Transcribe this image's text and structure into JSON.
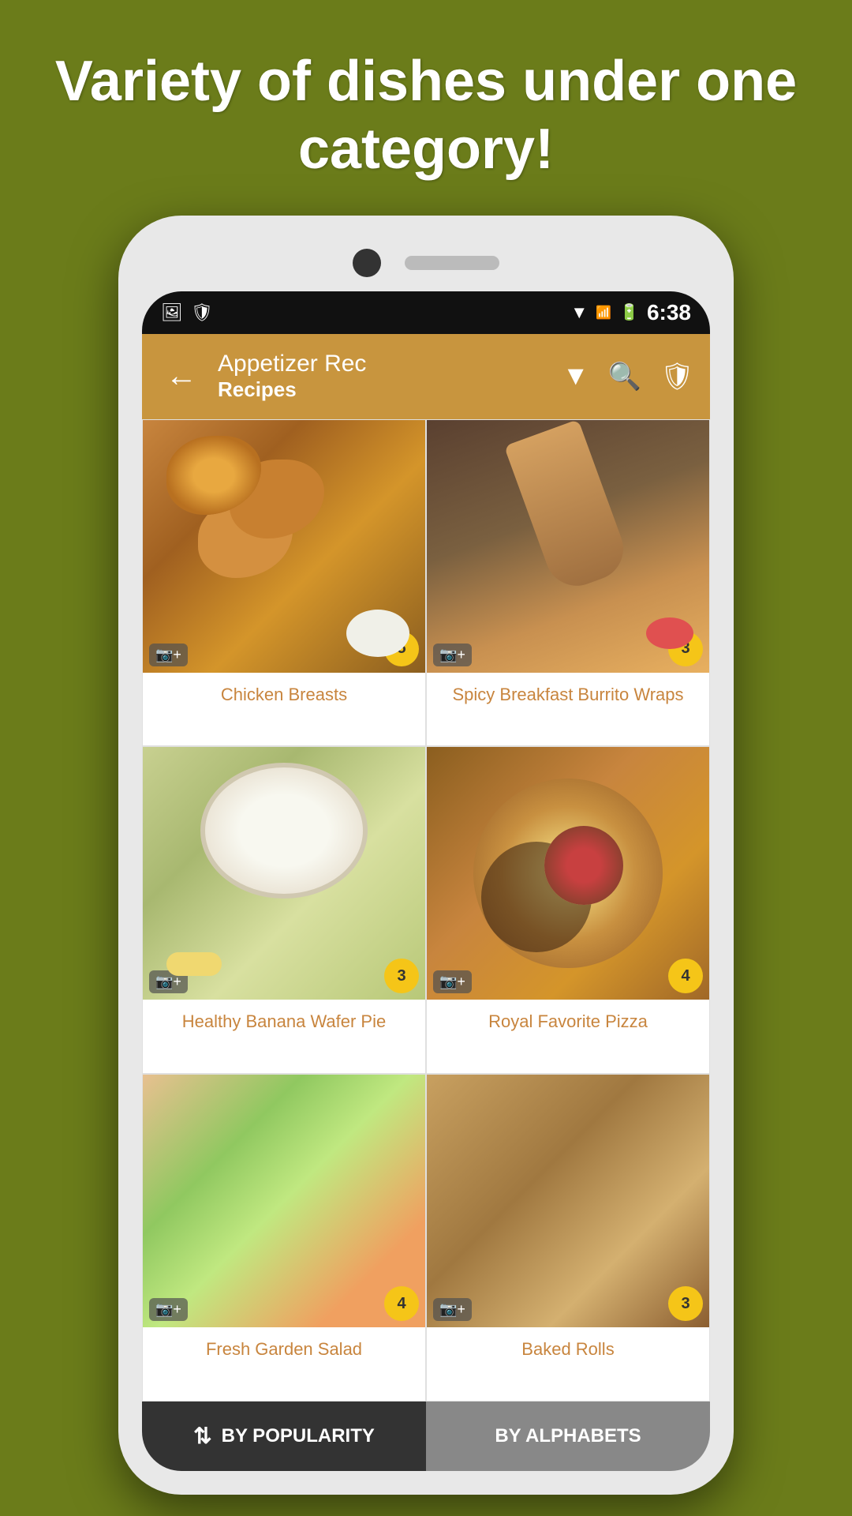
{
  "header": {
    "title": "Variety of dishes under one category!"
  },
  "statusBar": {
    "time": "6:38",
    "icons": [
      "image",
      "shield"
    ]
  },
  "appBar": {
    "title": "Appetizer Rec",
    "subtitle": "Recipes",
    "backLabel": "←",
    "filterLabel": "▼",
    "searchLabel": "🔍",
    "profileLabel": "🛡"
  },
  "recipes": [
    {
      "id": "chicken-breasts",
      "name": "Chicken Breasts",
      "rating": 5,
      "imageClass": "img-chicken"
    },
    {
      "id": "spicy-breakfast-burrito",
      "name": "Spicy Breakfast Burrito Wraps",
      "rating": 3,
      "imageClass": "img-burrito"
    },
    {
      "id": "healthy-banana-wafer-pie",
      "name": "Healthy Banana Wafer Pie",
      "rating": 3,
      "imageClass": "img-banana-pie"
    },
    {
      "id": "royal-favorite-pizza",
      "name": "Royal Favorite Pizza",
      "rating": 4,
      "imageClass": "img-pizza"
    },
    {
      "id": "salad-dish",
      "name": "Fresh Garden Salad",
      "rating": 4,
      "imageClass": "img-salad"
    },
    {
      "id": "rolls-dish",
      "name": "Baked Rolls",
      "rating": 3,
      "imageClass": "img-rolls"
    }
  ],
  "bottomBar": {
    "sortByPopularity": "BY POPULARITY",
    "sortByAlphabets": "BY ALPHABETS",
    "sortIcon": "⇅"
  }
}
